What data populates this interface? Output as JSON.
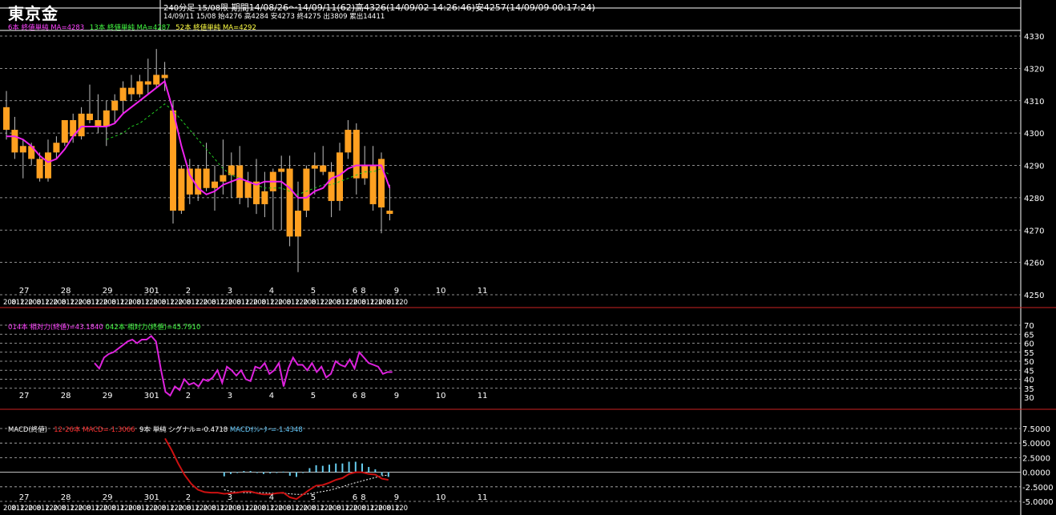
{
  "header": {
    "title": "東京金",
    "period_label": "240分足 15/08限",
    "period_info": "期間14/08/26～14/09/11(62)高4326(14/09/02 14:26:46)安4257(14/09/09 00:17:24)",
    "last_bar": "14/09/11 15/08 始4276 高4284 安4273 終4275 出3809 累出14411"
  },
  "ma_legend": [
    {
      "text": "6本 終値単純 MA=4283",
      "color": "#ff44ff"
    },
    {
      "text": "13本 終値単純 MA=4287",
      "color": "#44ff44"
    },
    {
      "text": "52本 終値単純 MA=4292",
      "color": "#ffff44"
    }
  ],
  "rsi_legend": [
    {
      "text": "014本 相対力(終値)=43.1840",
      "color": "#ff44ff"
    },
    {
      "text": "042本 相対力(終値)=45.7910",
      "color": "#44ff44"
    }
  ],
  "macd_legend": [
    {
      "text": "MACD(終値)",
      "color": "#ffffff"
    },
    {
      "text": "12-26本 MACD=-1.3066",
      "color": "#ff3333"
    },
    {
      "text": "9本 単純 シグナル=-0.4718",
      "color": "#ffffff"
    },
    {
      "text": "MACDｵｼﾚｰﾀｰ=-1.4348",
      "color": "#66ccff"
    }
  ],
  "colors": {
    "candle": "#ffa020",
    "wick": "#c0c0c0",
    "ma6": "#ee22ee",
    "ma13": "#22cc22",
    "grid": "#bbbbbb",
    "rsi": "#dd22dd",
    "macd": "#cc1111",
    "signal": "#ffffff",
    "osc": "#66ccee"
  },
  "chart_data": [
    {
      "type": "candlestick",
      "ylim": [
        4250,
        4330
      ],
      "yticks": [
        4250,
        4260,
        4270,
        4280,
        4290,
        4300,
        4310,
        4320,
        4330
      ],
      "date_labels": [
        "27",
        "28",
        "29",
        "301",
        "2",
        "3",
        "4",
        "5",
        "6",
        "8",
        "9",
        "10",
        "11"
      ],
      "date_label_bars": [
        2,
        7,
        12,
        17,
        22,
        27,
        32,
        37,
        42,
        43,
        47,
        52,
        57
      ],
      "time_labels": [
        "200",
        "812",
        "120"
      ],
      "candles": [
        [
          4308,
          4313,
          4298,
          4301
        ],
        [
          4301,
          4305,
          4292,
          4294
        ],
        [
          4294,
          4298,
          4286,
          4296
        ],
        [
          4296,
          4297,
          4290,
          4292
        ],
        [
          4292,
          4294,
          4285,
          4286
        ],
        [
          4286,
          4298,
          4285,
          4294
        ],
        [
          4294,
          4299,
          4292,
          4297
        ],
        [
          4297,
          4304,
          4296,
          4304
        ],
        [
          4304,
          4306,
          4297,
          4299
        ],
        [
          4299,
          4308,
          4298,
          4306
        ],
        [
          4306,
          4315,
          4303,
          4304
        ],
        [
          4304,
          4312,
          4300,
          4302
        ],
        [
          4302,
          4310,
          4296,
          4307
        ],
        [
          4307,
          4312,
          4303,
          4310
        ],
        [
          4310,
          4316,
          4306,
          4314
        ],
        [
          4314,
          4318,
          4310,
          4312
        ],
        [
          4312,
          4318,
          4311,
          4316
        ],
        [
          4316,
          4323,
          4312,
          4315
        ],
        [
          4315,
          4326,
          4314,
          4318
        ],
        [
          4318,
          4322,
          4313,
          4317
        ],
        [
          4307,
          4310,
          4272,
          4276
        ],
        [
          4276,
          4290,
          4275,
          4289
        ],
        [
          4289,
          4292,
          4278,
          4281
        ],
        [
          4281,
          4290,
          4279,
          4289
        ],
        [
          4289,
          4297,
          4282,
          4283
        ],
        [
          4283,
          4290,
          4276,
          4285
        ],
        [
          4285,
          4298,
          4281,
          4287
        ],
        [
          4287,
          4294,
          4280,
          4290
        ],
        [
          4290,
          4296,
          4278,
          4280
        ],
        [
          4280,
          4288,
          4277,
          4285
        ],
        [
          4285,
          4292,
          4275,
          4278
        ],
        [
          4278,
          4288,
          4274,
          4282
        ],
        [
          4282,
          4289,
          4270,
          4288
        ],
        [
          4288,
          4293,
          4270,
          4289
        ],
        [
          4289,
          4293,
          4265,
          4268
        ],
        [
          4268,
          4285,
          4257,
          4276
        ],
        [
          4276,
          4290,
          4274,
          4289
        ],
        [
          4289,
          4294,
          4281,
          4290
        ],
        [
          4290,
          4296,
          4287,
          4288
        ],
        [
          4288,
          4291,
          4274,
          4279
        ],
        [
          4279,
          4297,
          4276,
          4294
        ],
        [
          4294,
          4304,
          4292,
          4301
        ],
        [
          4301,
          4303,
          4281,
          4286
        ],
        [
          4286,
          4296,
          4284,
          4290
        ],
        [
          4290,
          4296,
          4276,
          4278
        ],
        [
          4292,
          4294,
          4269,
          4277
        ],
        [
          4276,
          4284,
          4273,
          4275
        ]
      ],
      "ma6": [
        4299,
        4299,
        4298,
        4296,
        4293,
        4291,
        4292,
        4295,
        4299,
        4302,
        4302,
        4302,
        4302,
        4303,
        4306,
        4308,
        4310,
        4312,
        4314,
        4316,
        4307,
        4296,
        4287,
        4283,
        4281,
        4282,
        4284,
        4285,
        4286,
        4285,
        4284,
        4285,
        4285,
        4285,
        4283,
        4280,
        4280,
        4282,
        4283,
        4286,
        4287,
        4289,
        4290,
        4290,
        4290,
        4290,
        4283
      ],
      "ma13": [
        null,
        null,
        null,
        null,
        null,
        null,
        null,
        null,
        null,
        null,
        null,
        null,
        4298,
        4299,
        4300,
        4302,
        4303,
        4305,
        4307,
        4309,
        4307,
        4304,
        4301,
        4298,
        4295,
        4292,
        4289,
        4287,
        4286,
        4285,
        4284,
        4283,
        4283,
        4283,
        4282,
        4281,
        4282,
        4283,
        4284,
        4284,
        4285,
        4286,
        4287,
        4288,
        4288,
        4289,
        4287
      ]
    },
    {
      "type": "line",
      "ylim": [
        30,
        70
      ],
      "yticks": [
        30,
        35,
        40,
        45,
        50,
        55,
        60,
        65,
        70
      ],
      "date_labels": [
        "27",
        "28",
        "29",
        "301",
        "2",
        "3",
        "4",
        "5",
        "6",
        "8",
        "9",
        "10",
        "11"
      ],
      "series": [
        {
          "name": "014本 相対力(終値)",
          "values": [
            49,
            46,
            52,
            54,
            55,
            57,
            59,
            61,
            62,
            60,
            62,
            62,
            64,
            61,
            46,
            33,
            31,
            36,
            34,
            40,
            37,
            38,
            36,
            40,
            39,
            41,
            45,
            38,
            47,
            45,
            42,
            45,
            40,
            39,
            47,
            46,
            49,
            43,
            45,
            49,
            36,
            46,
            52,
            48,
            48,
            45,
            49,
            44,
            47,
            41,
            43,
            50,
            48,
            47,
            51,
            46,
            55,
            52,
            49,
            48,
            47,
            43,
            44,
            44
          ]
        }
      ]
    },
    {
      "type": "line",
      "ylim": [
        -5,
        7.5
      ],
      "yticks": [
        -5,
        -2.5,
        0,
        2.5,
        5,
        7.5
      ],
      "date_labels": [
        "27",
        "28",
        "29",
        "301",
        "2",
        "3",
        "4",
        "5",
        "6",
        "8",
        "9",
        "10",
        "11"
      ],
      "series": [
        {
          "name": "12-26本 MACD",
          "values": [
            5.8,
            3.8,
            1.5,
            -0.5,
            -2.0,
            -3.0,
            -3.4,
            -3.5,
            -3.5,
            -3.7,
            -3.6,
            -3.5,
            -3.3,
            -3.3,
            -3.6,
            -3.8,
            -3.8,
            -3.6,
            -3.5,
            -4.3,
            -4.6,
            -3.8,
            -3.0,
            -2.3,
            -2.2,
            -1.8,
            -1.3,
            -1.0,
            -0.3,
            0.0,
            0.0,
            -0.3,
            -0.4,
            -1.1,
            -1.3
          ]
        },
        {
          "name": "9本 単純 シグナル",
          "values": [
            null,
            null,
            null,
            null,
            null,
            null,
            null,
            null,
            null,
            -3.0,
            -3.3,
            -3.4,
            -3.5,
            -3.5,
            -3.5,
            -3.5,
            -3.6,
            -3.6,
            -3.6,
            -3.7,
            -3.8,
            -3.8,
            -3.7,
            -3.5,
            -3.3,
            -3.1,
            -2.8,
            -2.5,
            -2.1,
            -1.8,
            -1.5,
            -1.2,
            -0.9,
            -0.6,
            -0.5
          ]
        },
        {
          "name": "MACDｵｼﾚｰﾀｰ",
          "values": [
            null,
            null,
            null,
            null,
            null,
            null,
            null,
            null,
            null,
            -0.7,
            -0.3,
            -0.1,
            0.2,
            0.2,
            -0.1,
            -0.3,
            -0.2,
            0.0,
            0.1,
            -0.6,
            -0.8,
            0.0,
            0.7,
            1.2,
            1.1,
            1.3,
            1.5,
            1.5,
            1.8,
            1.8,
            1.5,
            0.9,
            0.5,
            -0.5,
            -0.8
          ]
        }
      ]
    }
  ]
}
